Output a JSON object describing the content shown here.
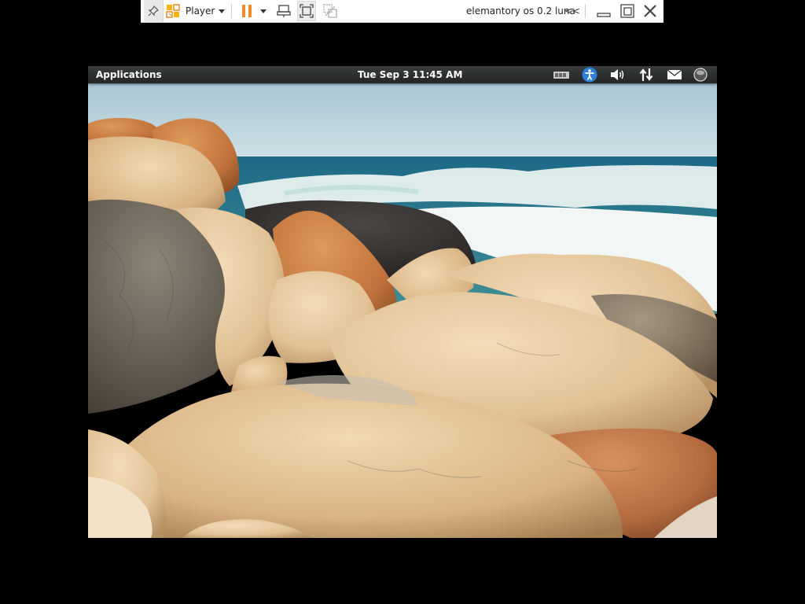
{
  "toolbar": {
    "player_label": "Player",
    "vm_title": "elemantory os 0.2 luna",
    "collapse_label": "<<"
  },
  "panel": {
    "applications_label": "Applications",
    "clock": "Tue Sep  3 11:45 AM"
  },
  "colors": {
    "accent_orange": "#f08a24",
    "panel_bg": "#2e3131",
    "a11y_blue": "#2d7fd8"
  }
}
